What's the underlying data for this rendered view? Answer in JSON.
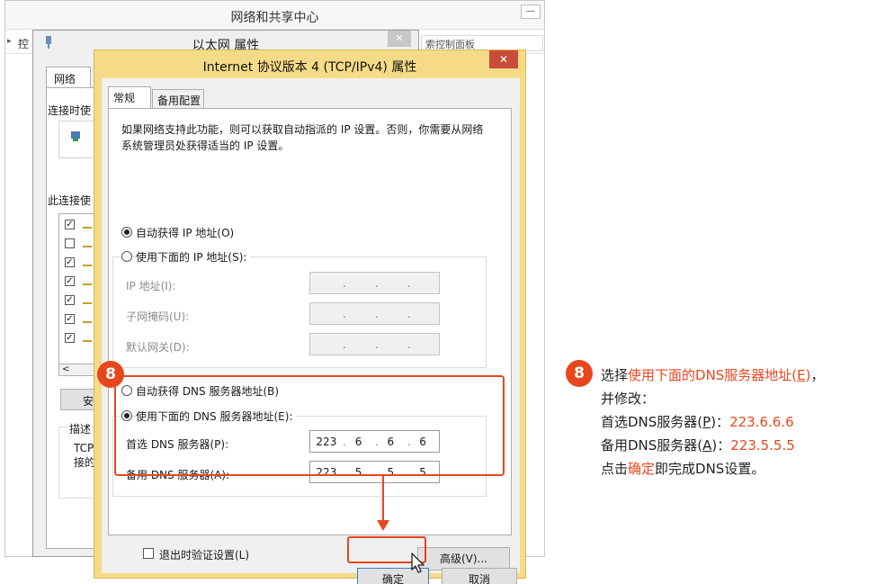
{
  "background_window": {
    "title": "网络和共享中心",
    "nav_text": "控",
    "search_placeholder": "索控制面板"
  },
  "ethernet_dialog": {
    "title": "以太网 属性",
    "close_label": "✕",
    "tab_label": "网络",
    "connect_using_label": "连接时使",
    "uses_items_label": "此连接使",
    "items_checked": [
      true,
      false,
      true,
      true,
      true,
      true,
      true
    ],
    "hscroll_arrow": "<",
    "install_button_partial": "安",
    "description_legend": "描述",
    "description_text": "TCP/接的"
  },
  "ipv4_dialog": {
    "title": "Internet 协议版本 4 (TCP/IPv4) 属性",
    "close_label": "✕",
    "tabs": [
      {
        "label": "常规",
        "active": true
      },
      {
        "label": "备用配置",
        "active": false
      }
    ],
    "intro_text": "如果网络支持此功能，则可以获取自动指派的 IP 设置。否则，你需要从网络系统管理员处获得适当的 IP 设置。",
    "ip_auto_label": "自动获得 IP 地址(O)",
    "ip_manual_label": "使用下面的 IP 地址(S):",
    "ip_auto_selected": true,
    "ip_fields": [
      {
        "label": "IP 地址(I):",
        "octets": [
          "",
          "",
          "",
          ""
        ]
      },
      {
        "label": "子网掩码(U):",
        "octets": [
          "",
          "",
          "",
          ""
        ]
      },
      {
        "label": "默认网关(D):",
        "octets": [
          "",
          "",
          "",
          ""
        ]
      }
    ],
    "dns_auto_label": "自动获得 DNS 服务器地址(B)",
    "dns_manual_label": "使用下面的 DNS 服务器地址(E):",
    "dns_manual_selected": true,
    "dns_fields": [
      {
        "label": "首选 DNS 服务器(P):",
        "octets": [
          "223",
          "6",
          "6",
          "6"
        ]
      },
      {
        "label": "备用 DNS 服务器(A):",
        "octets": [
          "223",
          "5",
          "5",
          "5"
        ]
      }
    ],
    "validate_label": "退出时验证设置(L)",
    "validate_checked": false,
    "advanced_button": "高级(V)...",
    "ok_button": "确定",
    "cancel_button": "取消"
  },
  "annotation": {
    "step_number": "8",
    "accent_color": "#e8471e",
    "line1_prefix": "选择",
    "line1_highlight": "使用下面的DNS服务器地址(",
    "line1_key": "E",
    "line1_highlight_end": ")",
    "line1_suffix": "，",
    "line2": "并修改：",
    "line3_label": "首选DNS服务器(",
    "line3_key": "P",
    "line3_label_end": ")：",
    "line3_value": "223.6.6.6",
    "line4_label": "备用DNS服务器(",
    "line4_key": "A",
    "line4_label_end": ")：",
    "line4_value": "223.5.5.5",
    "line5_prefix": "点击",
    "line5_highlight": "确定",
    "line5_suffix": "即完成DNS设置。"
  }
}
